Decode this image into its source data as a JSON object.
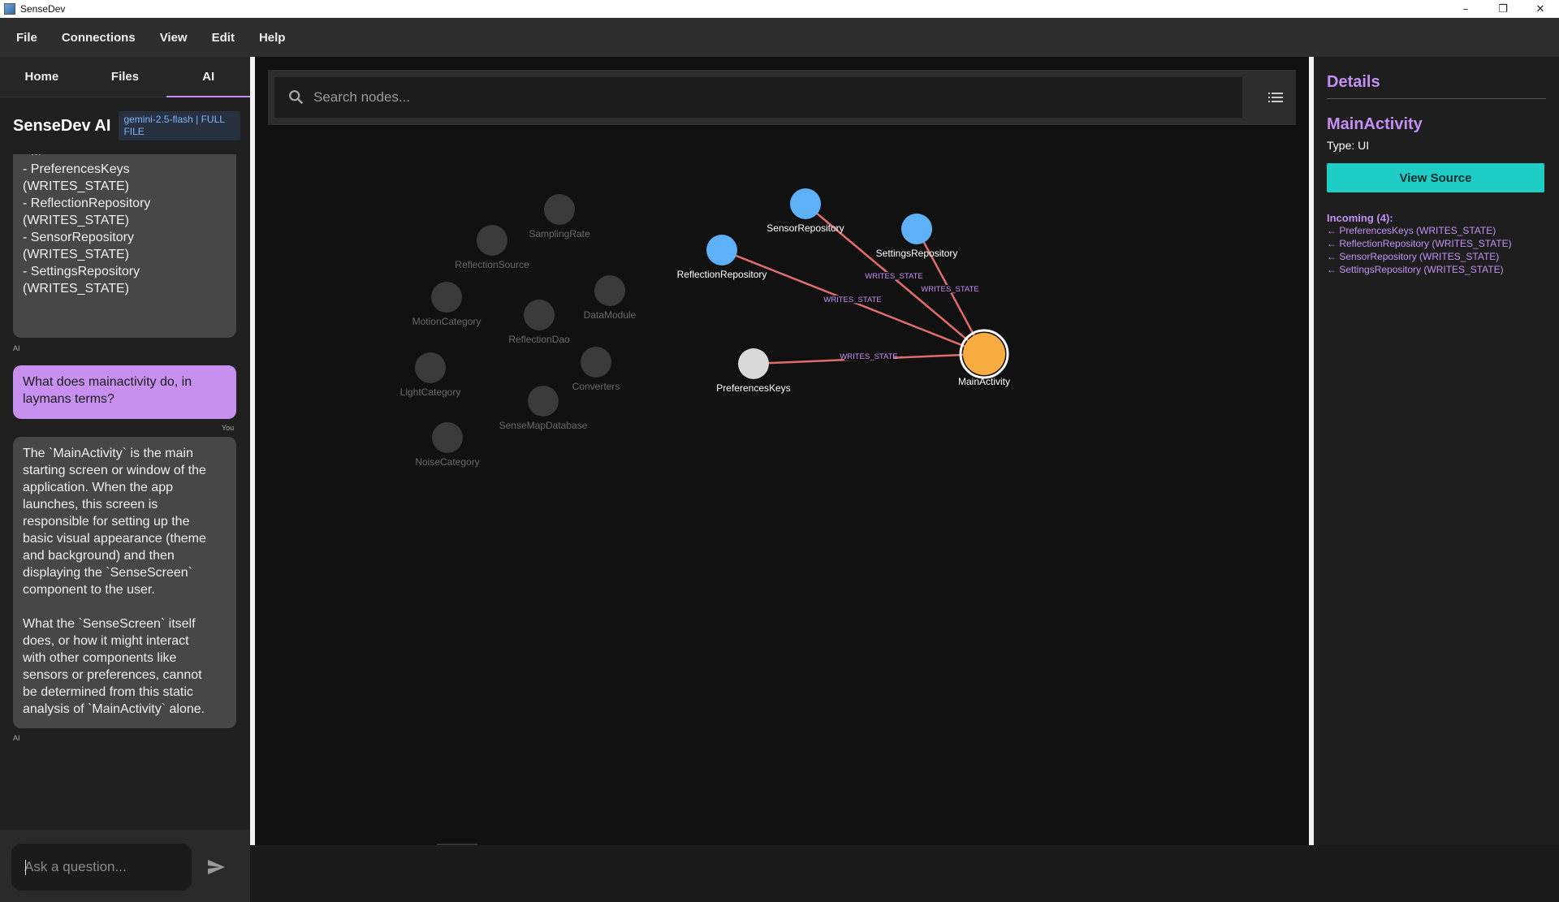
{
  "window": {
    "title": "SenseDev",
    "controls": [
      "–",
      "❐",
      "✕"
    ]
  },
  "menubar": [
    "File",
    "Connections",
    "View",
    "Edit",
    "Help"
  ],
  "sidebar": {
    "tabs": [
      {
        "label": "Home"
      },
      {
        "label": "Files"
      },
      {
        "label": "AI"
      }
    ],
    "ai_title": "SenseDev AI",
    "model_badge": "gemini-2.5-flash | FULL FILE",
    "messages": [
      {
        "role": "AI",
        "lines": [
          "- PreferencesKeys",
          "(WRITES_STATE)",
          "- ReflectionRepository",
          "(WRITES_STATE)",
          "- SensorRepository",
          "(WRITES_STATE)",
          "- SettingsRepository",
          "(WRITES_STATE)"
        ],
        "sender": "AI"
      },
      {
        "role": "user",
        "lines": [
          "What does mainactivity do, in",
          "laymans terms?"
        ],
        "sender": "You"
      },
      {
        "role": "AI",
        "lines": [
          "The `MainActivity` is the main",
          "starting screen or window of the",
          "application. When the app",
          "launches, this screen is",
          "responsible for setting up the",
          "basic visual appearance (theme",
          "and background) and then",
          "displaying the `SenseScreen`",
          "component to the user.",
          "",
          "What the `SenseScreen` itself",
          "does, or how it might interact",
          "with other components like",
          "sensors or preferences, cannot",
          "be determined from this static",
          "analysis of `MainActivity` alone."
        ],
        "sender": "AI"
      }
    ],
    "ask_placeholder": "Ask a question..."
  },
  "graph": {
    "search_placeholder": "Search nodes...",
    "colors": {
      "faded": "#3b3b3b",
      "faded_label": "#6a6a6a",
      "connected": "#5eb1f7",
      "selected": "#f9ad41",
      "neutral": "#d9d9d9",
      "edge": "#e06c6c"
    },
    "nodes": [
      {
        "id": "SamplingRate",
        "label": "SamplingRate",
        "state": "faded"
      },
      {
        "id": "ReflectionSource",
        "label": "ReflectionSource",
        "state": "faded"
      },
      {
        "id": "MotionCategory",
        "label": "MotionCategory",
        "state": "faded"
      },
      {
        "id": "DataModule",
        "label": "DataModule",
        "state": "faded"
      },
      {
        "id": "ReflectionDao",
        "label": "ReflectionDao",
        "state": "faded"
      },
      {
        "id": "LightCategory",
        "label": "LightCategory",
        "state": "faded"
      },
      {
        "id": "Converters",
        "label": "Converters",
        "state": "faded"
      },
      {
        "id": "SenseMapDatabase",
        "label": "SenseMapDatabase",
        "state": "faded"
      },
      {
        "id": "NoiseCategory",
        "label": "NoiseCategory",
        "state": "faded"
      },
      {
        "id": "SensorRepository",
        "label": "SensorRepository",
        "state": "connected"
      },
      {
        "id": "SettingsRepository",
        "label": "SettingsRepository",
        "state": "connected"
      },
      {
        "id": "ReflectionRepository",
        "label": "ReflectionRepository",
        "state": "connected"
      },
      {
        "id": "PreferencesKeys",
        "label": "PreferencesKeys",
        "state": "neutral"
      },
      {
        "id": "MainActivity",
        "label": "MainActivity",
        "state": "selected"
      }
    ],
    "edges": [
      {
        "from": "SensorRepository",
        "to": "MainActivity",
        "label": "WRITES_STATE"
      },
      {
        "from": "SettingsRepository",
        "to": "MainActivity",
        "label": "WRITES_STATE"
      },
      {
        "from": "ReflectionRepository",
        "to": "MainActivity",
        "label": "WRITES_STATE"
      },
      {
        "from": "PreferencesKeys",
        "to": "MainActivity",
        "label": "WRITES_STATE"
      }
    ]
  },
  "details": {
    "title": "Details",
    "node_name": "MainActivity",
    "node_type": "Type: UI",
    "view_source_label": "View Source",
    "incoming_title": "Incoming (4):",
    "incoming": [
      "← PreferencesKeys (WRITES_STATE)",
      "← ReflectionRepository (WRITES_STATE)",
      "← SensorRepository (WRITES_STATE)",
      "← SettingsRepository (WRITES_STATE)"
    ]
  }
}
